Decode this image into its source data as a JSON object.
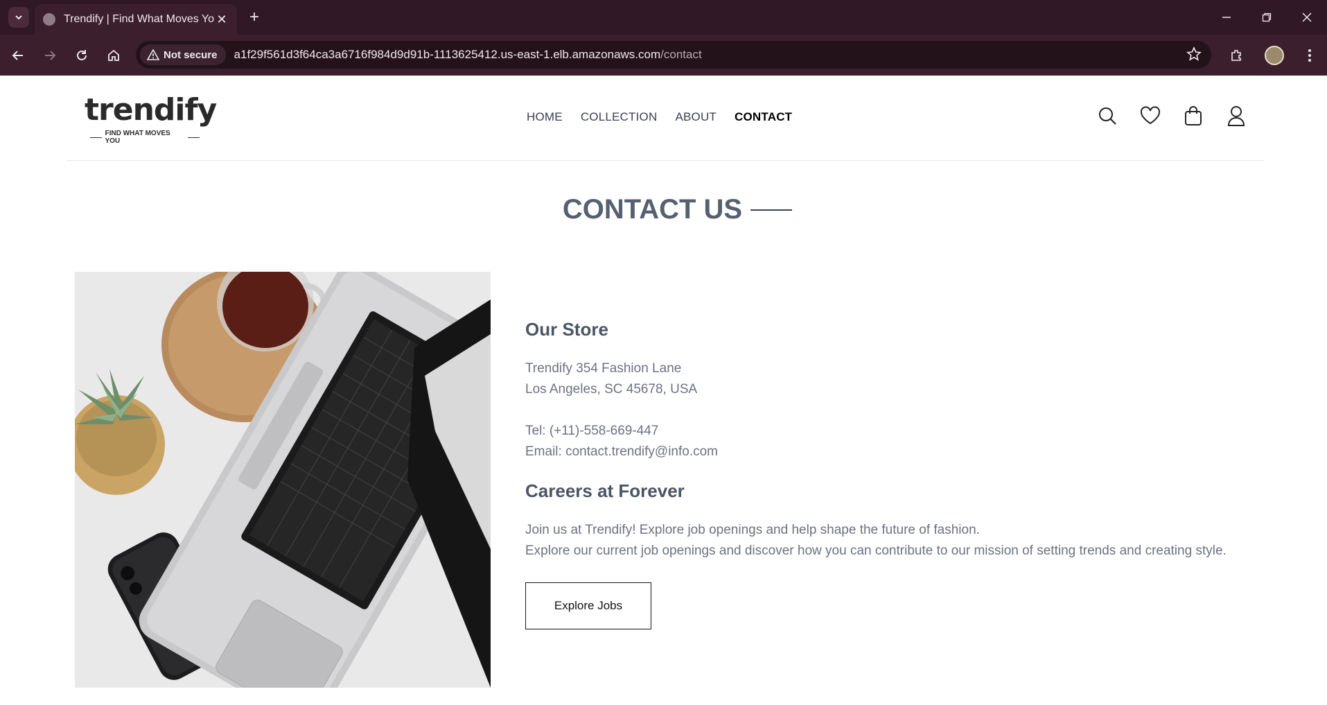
{
  "browser": {
    "tab_title": "Trendify | Find What Moves You",
    "security_label": "Not secure",
    "url_host": "a1f29f561d3f64ca3a6716f984d9d91b-1113625412.us-east-1.elb.amazonaws.com",
    "url_path": "/contact"
  },
  "header": {
    "logo_text": "trendify",
    "logo_tagline": "FIND WHAT MOVES YOU",
    "nav": [
      "HOME",
      "COLLECTION",
      "ABOUT",
      "CONTACT"
    ],
    "active_nav": "CONTACT"
  },
  "page": {
    "title": "CONTACT US",
    "store_heading": "Our Store",
    "address_line1": "Trendify 354 Fashion Lane",
    "address_line2": "Los Angeles, SC 45678, USA",
    "tel": "Tel: (+11)-558-669-447",
    "email": "Email: contact.trendify@info.com",
    "careers_heading": "Careers at Forever",
    "careers_line1": "Join us at Trendify! Explore job openings and help shape the future of fashion.",
    "careers_line2": "Explore our current job openings and discover how you can contribute to our mission of setting trends and creating style.",
    "cta_label": "Explore Jobs"
  },
  "colors": {
    "chrome_bg": "#3b1f2d",
    "title_text": "#556070",
    "body_text": "#6b7280"
  }
}
